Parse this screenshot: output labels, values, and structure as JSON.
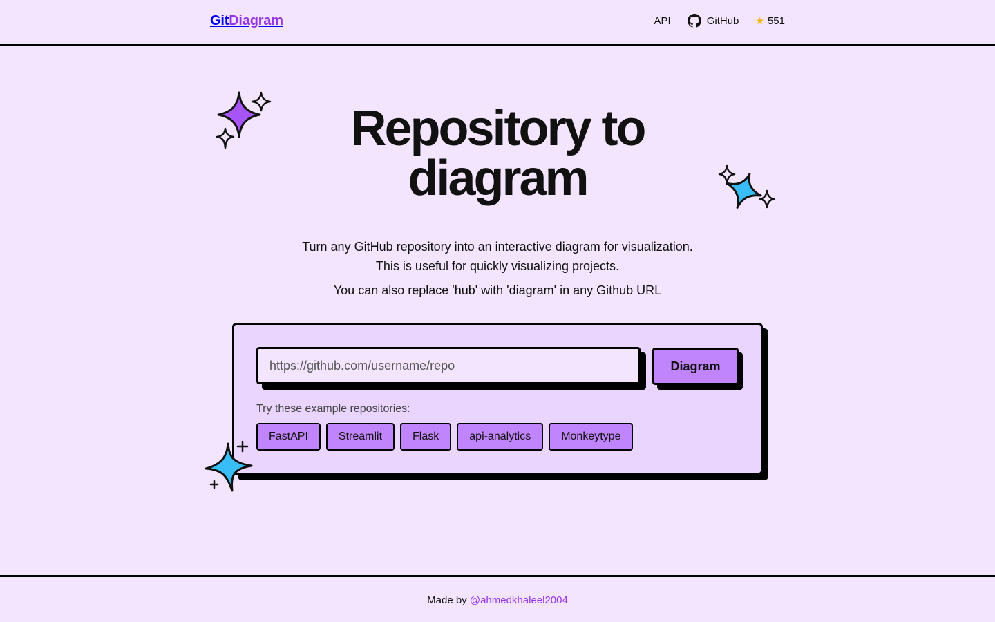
{
  "header": {
    "logo_part1": "Git",
    "logo_part2": "Diagram",
    "nav_api": "API",
    "nav_github": "GitHub",
    "star_count": "551"
  },
  "hero": {
    "title_line1": "Repository to",
    "title_line2": "diagram",
    "subtitle_line1": "Turn any GitHub repository into an interactive diagram for visualization.",
    "subtitle_line2": "This is useful for quickly visualizing projects.",
    "tip": "You can also replace 'hub' with 'diagram' in any Github URL"
  },
  "form": {
    "input_placeholder": "https://github.com/username/repo",
    "input_value": "",
    "submit_label": "Diagram",
    "examples_label": "Try these example repositories:",
    "examples": [
      "FastAPI",
      "Streamlit",
      "Flask",
      "api-analytics",
      "Monkeytype"
    ]
  },
  "footer": {
    "made_by": "Made by ",
    "author_link": "@ahmedkhaleel2004"
  },
  "colors": {
    "background": "#f3e5fd",
    "accent": "#9333ea",
    "button": "#c084fc",
    "card": "#e9d5fe",
    "sparkle_purple": "#a855f7",
    "sparkle_blue": "#38bdf8",
    "star": "#f5b301"
  },
  "icons": {
    "github": "github-icon",
    "star": "star-icon",
    "sparkles": "sparkle-icon"
  }
}
